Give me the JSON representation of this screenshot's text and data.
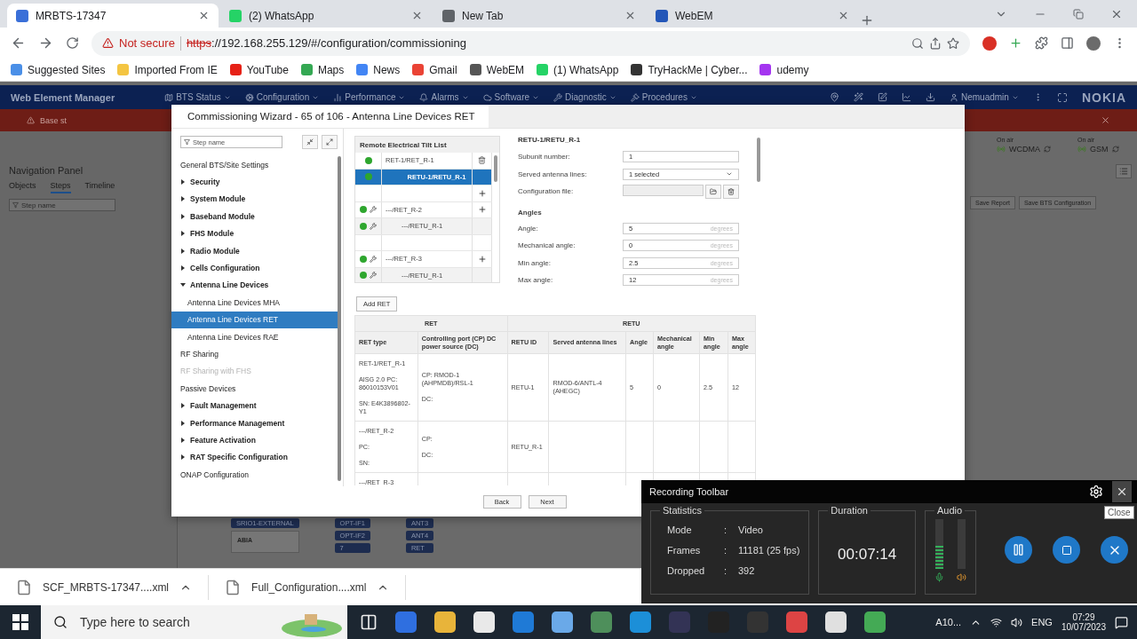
{
  "browser": {
    "tabs": [
      {
        "title": "MRBTS-17347",
        "selected": true
      },
      {
        "title": "(2) WhatsApp",
        "selected": false
      },
      {
        "title": "New Tab",
        "selected": false
      },
      {
        "title": "WebEM",
        "selected": false
      }
    ],
    "security": "Not secure",
    "scheme": "https",
    "url": "://192.168.255.129/#/configuration/commissioning",
    "bookmarks": [
      "Suggested Sites",
      "Imported From IE",
      "YouTube",
      "Maps",
      "News",
      "Gmail",
      "WebEM",
      "(1) WhatsApp",
      "TryHackMe | Cyber...",
      "udemy"
    ]
  },
  "app": {
    "title": "Web Element Manager",
    "menu": [
      "BTS Status",
      "Configuration",
      "Performance",
      "Alarms",
      "Software",
      "Diagnostic",
      "Procedures"
    ],
    "user": "Nemuadmin",
    "brand": "NOKIA",
    "alert": "Base st",
    "nav": {
      "title": "Navigation Panel",
      "tabs": [
        {
          "label": "Objects",
          "selected": false
        },
        {
          "label": "Steps",
          "selected": true
        },
        {
          "label": "Timeline",
          "selected": false
        }
      ],
      "filter_placeholder": "Step name"
    },
    "radios": [
      {
        "status": "On air",
        "name": "WCDMA"
      },
      {
        "status": "On air",
        "name": "GSM"
      }
    ],
    "actions": [
      "Save Report",
      "Save BTS Configuration"
    ],
    "diagram": {
      "ports": [
        "SRIO1-EXTERNAL"
      ],
      "card": "ABIA",
      "links": [
        "OPT-IF1",
        "OPT-IF2",
        "7"
      ],
      "antennas": [
        "ANT3",
        "ANT4",
        "RET"
      ]
    }
  },
  "wizard": {
    "title": "Commissioning Wizard - 65 of 106 - Antenna Line Devices RET",
    "filter_placeholder": "Step name",
    "steps": [
      {
        "kind": "step",
        "label": "General BTS/Site Settings",
        "selected": false,
        "disabled": false
      },
      {
        "kind": "group",
        "label": "Security",
        "expanded": false,
        "selected": false,
        "disabled": false
      },
      {
        "kind": "group",
        "label": "System Module",
        "expanded": false,
        "selected": false,
        "disabled": false
      },
      {
        "kind": "group",
        "label": "Baseband Module",
        "expanded": false,
        "selected": false,
        "disabled": false
      },
      {
        "kind": "group",
        "label": "FHS Module",
        "expanded": false,
        "selected": false,
        "disabled": false
      },
      {
        "kind": "group",
        "label": "Radio Module",
        "expanded": false,
        "selected": false,
        "disabled": false
      },
      {
        "kind": "group",
        "label": "Cells Configuration",
        "expanded": false,
        "selected": false,
        "disabled": false
      },
      {
        "kind": "group",
        "label": "Antenna Line Devices",
        "expanded": true,
        "selected": false,
        "disabled": false,
        "children": [
          {
            "kind": "step",
            "label": "Antenna Line Devices MHA",
            "selected": false,
            "disabled": false
          },
          {
            "kind": "step",
            "label": "Antenna Line Devices RET",
            "selected": true,
            "disabled": false
          },
          {
            "kind": "step",
            "label": "Antenna Line Devices RAE",
            "selected": false,
            "disabled": false
          }
        ]
      },
      {
        "kind": "step",
        "label": "RF Sharing",
        "selected": false,
        "disabled": false
      },
      {
        "kind": "step",
        "label": "RF Sharing with FHS",
        "selected": false,
        "disabled": true
      },
      {
        "kind": "step",
        "label": "Passive Devices",
        "selected": false,
        "disabled": false
      },
      {
        "kind": "group",
        "label": "Fault Management",
        "expanded": false,
        "selected": false,
        "disabled": false
      },
      {
        "kind": "group",
        "label": "Performance Management",
        "expanded": false,
        "selected": false,
        "disabled": false
      },
      {
        "kind": "group",
        "label": "Feature Activation",
        "expanded": false,
        "selected": false,
        "disabled": false
      },
      {
        "kind": "group",
        "label": "RAT Specific Configuration",
        "expanded": false,
        "selected": false,
        "disabled": false
      },
      {
        "kind": "step",
        "label": "ONAP Configuration",
        "selected": false,
        "disabled": false
      }
    ],
    "ret_list": {
      "title": "Remote Electrical Tilt List",
      "rows": [
        {
          "label": "RET-1/RET_R-1",
          "wrench": false,
          "deletable": true,
          "addable": false,
          "selected": false,
          "children": [
            {
              "kind": "retu",
              "label": "RETU-1/RETU_R-1",
              "wrench": false,
              "deletable": false,
              "addable": false,
              "selected": true
            },
            {
              "kind": "blank",
              "deletable": false,
              "addable": true,
              "selected": false
            }
          ]
        },
        {
          "label": "---/RET_R-2",
          "wrench": true,
          "deletable": false,
          "addable": true,
          "selected": false,
          "children": [
            {
              "kind": "retu",
              "label": "---/RETU_R-1",
              "wrench": true,
              "deletable": false,
              "addable": false,
              "selected": false
            },
            {
              "kind": "blank",
              "deletable": false,
              "addable": false,
              "selected": false
            }
          ]
        },
        {
          "label": "---/RET_R-3",
          "wrench": true,
          "deletable": false,
          "addable": true,
          "selected": false,
          "children": [
            {
              "kind": "retu",
              "label": "---/RETU_R-1",
              "wrench": true,
              "deletable": false,
              "addable": false,
              "selected": false
            }
          ]
        }
      ]
    },
    "add_button": "Add RET",
    "properties": {
      "title": "RETU-1/RETU_R-1",
      "fields": [
        {
          "kind": "text",
          "label": "Subunit number:",
          "value": "1"
        },
        {
          "kind": "select",
          "label": "Served antenna lines:",
          "value": "1 selected"
        },
        {
          "kind": "file",
          "label": "Configuration file:"
        },
        {
          "kind": "section",
          "label": "Angles"
        },
        {
          "kind": "unit",
          "label": "Angle:",
          "value": "5",
          "unit": "degrees"
        },
        {
          "kind": "unit",
          "label": "Mechanical angle:",
          "value": "0",
          "unit": "degrees"
        },
        {
          "kind": "unit",
          "label": "Min angle:",
          "value": "2.5",
          "unit": "degrees"
        },
        {
          "kind": "unit",
          "label": "Max angle:",
          "value": "12",
          "unit": "degrees"
        }
      ]
    },
    "table": {
      "groups": [
        {
          "label": "RET",
          "columns": [
            "RET type",
            "Controlling port (CP) DC power source (DC)"
          ]
        },
        {
          "label": "RETU",
          "columns": [
            "RETU ID",
            "Served antenna lines",
            "Angle",
            "Mechanical angle",
            "Min angle",
            "Max angle"
          ]
        }
      ],
      "rows": [
        {
          "cells": [
            [
              "RET-1/RET_R-1",
              "AISG 2.0 PC: 86010153V01",
              "SN: E4K3896802-Y1"
            ],
            [
              "CP: RMOD-1 (AHPMDB)/RSL-1",
              "DC:"
            ],
            [
              "RETU-1"
            ],
            [
              "RMOD-6/ANTL-4 (AHEGC)"
            ],
            [
              "5"
            ],
            [
              "0"
            ],
            [
              "2.5"
            ],
            [
              "12"
            ]
          ]
        },
        {
          "cells": [
            [
              "---/RET_R-2",
              "PC:",
              "SN:"
            ],
            [
              "CP:",
              "DC:"
            ],
            [
              "RETU_R-1"
            ]
          ]
        },
        {
          "cells": [
            [
              "---/RET_R-3"
            ]
          ]
        }
      ]
    },
    "buttons": [
      "Back",
      "Next"
    ]
  },
  "downloads": [
    "SCF_MRBTS-17347....xml",
    "Full_Configuration....xml"
  ],
  "recorder": {
    "title": "Recording Toolbar",
    "tooltip": "Close",
    "statistics": {
      "title": "Statistics",
      "rows": [
        {
          "label": "Mode",
          "separator": ":",
          "value": "Video"
        },
        {
          "label": "Frames",
          "separator": ":",
          "value": "11181 (25 fps)"
        },
        {
          "label": "Dropped",
          "separator": ":",
          "value": "392"
        }
      ]
    },
    "duration": {
      "title": "Duration",
      "value": "00:07:14"
    },
    "audio": {
      "title": "Audio",
      "meters": [
        {
          "kind": "microphone",
          "level": 0.5
        },
        {
          "kind": "speaker",
          "level": 0
        }
      ]
    }
  },
  "taskbar": {
    "search_placeholder": "Type here to search",
    "weather": "A10...",
    "language": "ENG",
    "time": "07:29",
    "date": "10/07/2023"
  }
}
